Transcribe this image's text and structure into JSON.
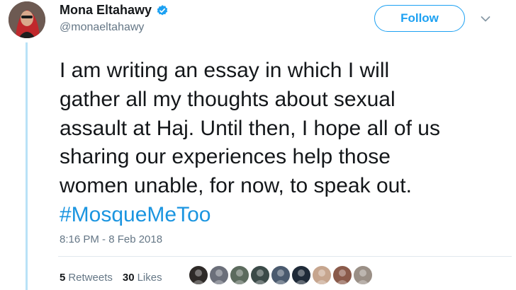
{
  "author": {
    "name": "Mona Eltahawy",
    "handle": "@monaeltahawy",
    "verified_icon": "verified-badge-icon"
  },
  "follow_button": {
    "label": "Follow"
  },
  "menu": {
    "icon": "chevron-down-icon"
  },
  "tweet": {
    "lines": [
      "I am writing an essay in which I will",
      "gather all my thoughts about sexual",
      "assault at Haj. Until then, I hope all of us",
      "sharing our experiences help those",
      "women unable, for now, to speak out."
    ],
    "hashtag": "#MosqueMeToo",
    "timestamp": "8:16 PM - 8 Feb 2018"
  },
  "stats": {
    "retweets": {
      "count": "5",
      "label": "Retweets"
    },
    "likes": {
      "count": "30",
      "label": "Likes"
    }
  },
  "likers": [
    {
      "color": "#2e2a28"
    },
    {
      "color": "#6b6f7a"
    },
    {
      "color": "#5c6b5e"
    },
    {
      "color": "#3b4a48"
    },
    {
      "color": "#4a5a6e"
    },
    {
      "color": "#1f2a38"
    },
    {
      "color": "#c6a58e"
    },
    {
      "color": "#8a5a4a"
    },
    {
      "color": "#9a8f86"
    }
  ],
  "colors": {
    "accent": "#1da1f2",
    "hashtag": "#1b95e0",
    "secondary_text": "#657786",
    "thread_line": "#b9e2f7"
  }
}
